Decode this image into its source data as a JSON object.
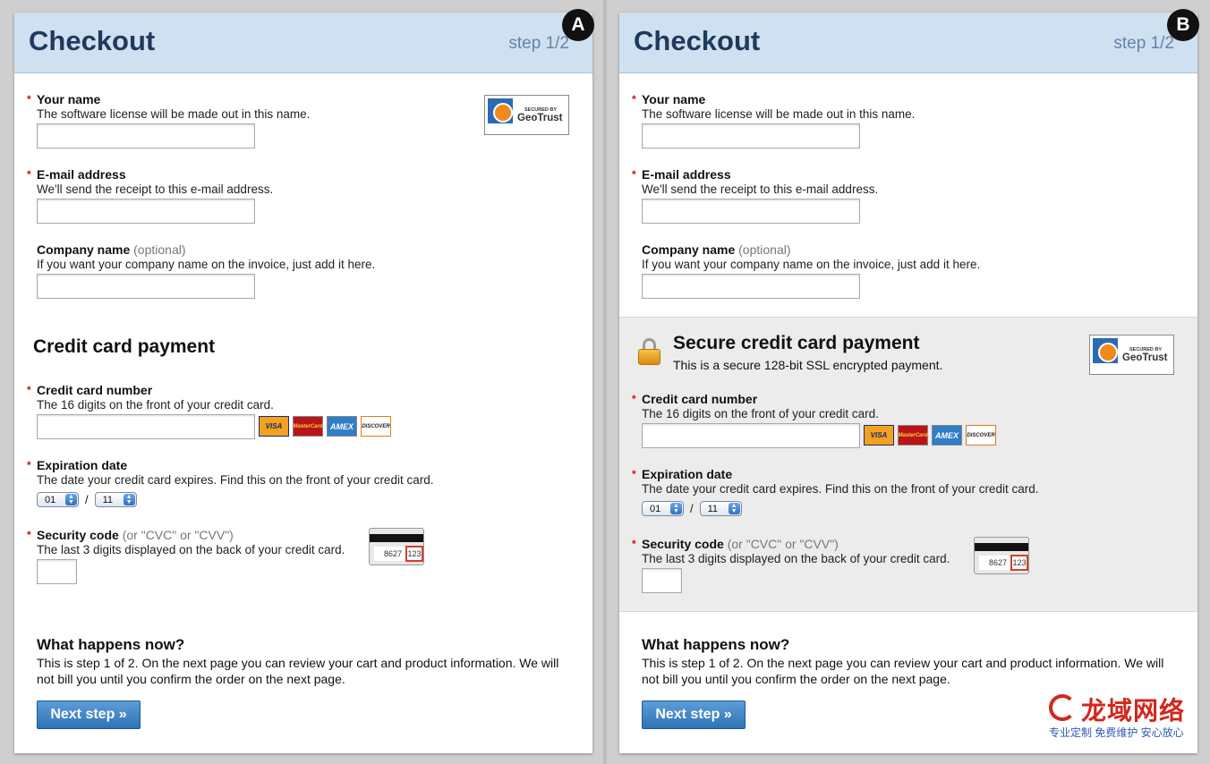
{
  "variants": [
    "A",
    "B"
  ],
  "common": {
    "title": "Checkout",
    "step": "step 1/2",
    "required_mark": "*",
    "your_name_label": "Your name",
    "your_name_help": "The software license will be made out in this name.",
    "email_label": "E-mail address",
    "email_help": "We'll send the receipt to this e-mail address.",
    "company_label": "Company name",
    "company_optional": "(optional)",
    "company_help": "If you want your company name on the invoice, just add it here.",
    "cc_number_label": "Credit card number",
    "cc_number_help": "The 16 digits on the front of your credit card.",
    "card_logos": [
      "VISA",
      "MasterCard",
      "AMEX",
      "DISCOVER"
    ],
    "expiration_label": "Expiration date",
    "expiration_help": "The date your credit card expires. Find this on the front of your credit card.",
    "exp_month": "01",
    "exp_year": "11",
    "exp_separator": "/",
    "security_label": "Security code",
    "security_alt": "(or \"CVC\" or \"CVV\")",
    "security_help": "The last 3 digits displayed on the back of your credit card.",
    "cvv_card_digits": "8627",
    "cvv_card_code": "123",
    "geotrust_small": "SECURED BY",
    "geotrust_name": "GeoTrust",
    "what_title": "What happens now?",
    "what_text": "This is step 1 of 2. On the next page you can review your cart and product information. We will not bill you until you confirm the order on the next page.",
    "next_button": "Next step »"
  },
  "panel_a": {
    "section_title": "Credit card payment"
  },
  "panel_b": {
    "section_title": "Secure credit card payment",
    "section_help": "This is a secure 128-bit SSL encrypted payment."
  },
  "watermark": {
    "main": "龙域网络",
    "sub": "专业定制 免费维护 安心放心"
  },
  "colors": {
    "header_bg": "#cfe1f0",
    "title_color": "#1f3a5c",
    "button_blue": "#2f73b6",
    "required_red": "#cc1111",
    "secure_band_bg": "#ececec"
  }
}
